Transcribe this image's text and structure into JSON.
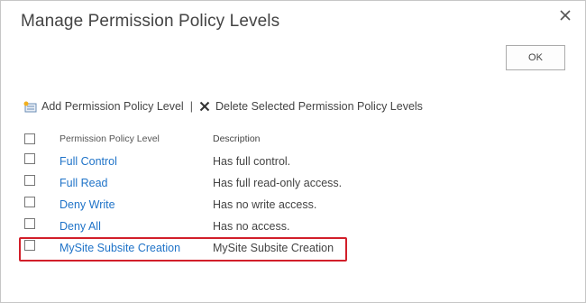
{
  "dialog": {
    "title": "Manage Permission Policy Levels",
    "ok_label": "OK"
  },
  "toolbar": {
    "add_label": "Add Permission Policy Level",
    "separator": "|",
    "delete_label": "Delete Selected Permission Policy Levels"
  },
  "table": {
    "headers": {
      "name": "Permission Policy Level",
      "description": "Description"
    },
    "rows": [
      {
        "name": "Full Control",
        "description": "Has full control."
      },
      {
        "name": "Full Read",
        "description": "Has full read-only access."
      },
      {
        "name": "Deny Write",
        "description": "Has no write access."
      },
      {
        "name": "Deny All",
        "description": "Has no access."
      },
      {
        "name": "MySite Subsite Creation",
        "description": "MySite Subsite Creation"
      }
    ]
  },
  "colors": {
    "link": "#1f73c8",
    "highlight": "#d21f2a",
    "text": "#444444"
  }
}
